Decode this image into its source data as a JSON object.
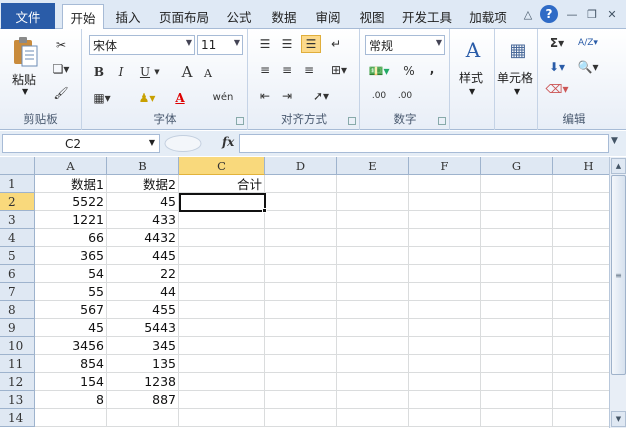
{
  "tabs": {
    "file": "文件",
    "items": [
      "开始",
      "插入",
      "页面布局",
      "公式",
      "数据",
      "审阅",
      "视图",
      "开发工具",
      "加载项"
    ],
    "active": "开始"
  },
  "ribbon": {
    "clipboard": {
      "paste": "粘贴",
      "label": "剪贴板"
    },
    "font": {
      "name": "宋体",
      "size": "11",
      "bold": "B",
      "italic": "I",
      "underline": "U",
      "grow": "A",
      "shrink": "A",
      "color_letter": "A",
      "wen": "wén",
      "label": "字体"
    },
    "alignment": {
      "label": "对齐方式"
    },
    "number": {
      "format": "常规",
      "percent": "%",
      "comma": ",",
      "dec_inc": ".00",
      "dec_dec": ".00",
      "label": "数字"
    },
    "styles": {
      "label": "样式"
    },
    "cells": {
      "label": "单元格"
    },
    "editing": {
      "sigma": "Σ",
      "sort": "A/Z",
      "label": "编辑"
    }
  },
  "formula_bar": {
    "name_box": "C2",
    "fx": "fx",
    "formula": ""
  },
  "sheet": {
    "columns": [
      "A",
      "B",
      "C",
      "D",
      "E",
      "F",
      "G",
      "H"
    ],
    "rows": [
      "1",
      "2",
      "3",
      "4",
      "5",
      "6",
      "7",
      "8",
      "9",
      "10",
      "11",
      "12",
      "13",
      "14"
    ],
    "active_cell": "C2",
    "cells": {
      "A": [
        "数据1",
        "5522",
        "1221",
        "66",
        "365",
        "54",
        "55",
        "567",
        "45",
        "3456",
        "854",
        "154",
        "8",
        ""
      ],
      "B": [
        "数据2",
        "45",
        "433",
        "4432",
        "445",
        "22",
        "44",
        "455",
        "5443",
        "345",
        "135",
        "1238",
        "887",
        ""
      ],
      "C": [
        "合计",
        "",
        "",
        "",
        "",
        "",
        "",
        "",
        "",
        "",
        "",
        "",
        "",
        ""
      ]
    }
  },
  "colors": {
    "accent": "#2a5ca8",
    "selected_header": "#f9d97c",
    "gridline": "#dadcdd"
  }
}
